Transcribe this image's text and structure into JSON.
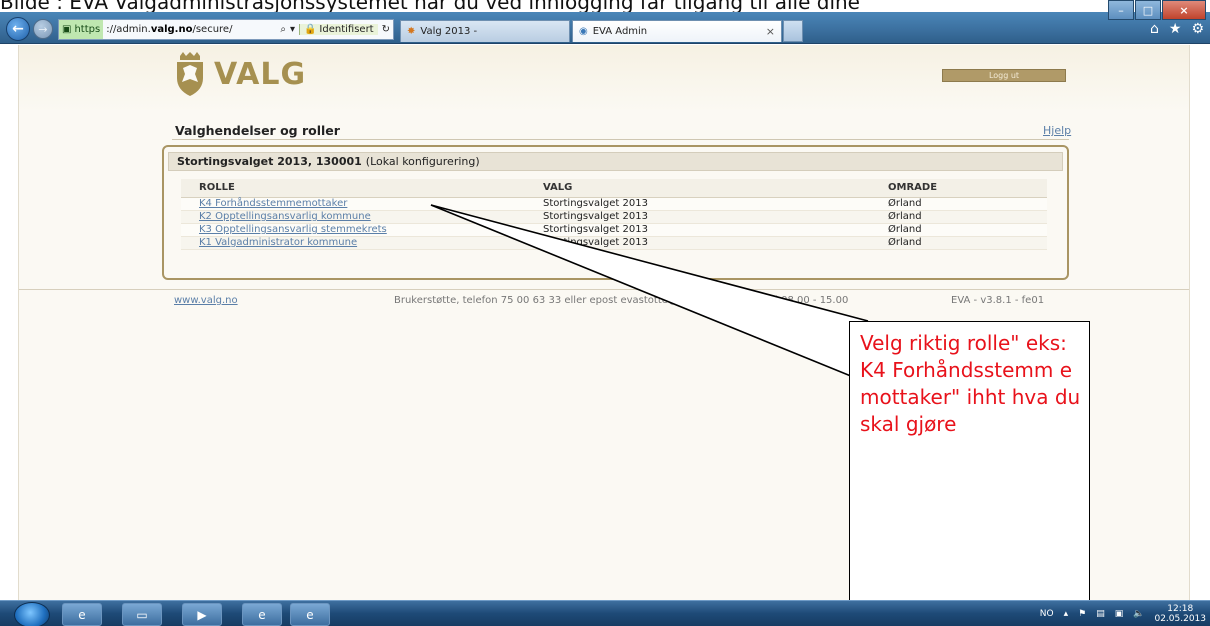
{
  "caption": "Bilde : EVA Valgadministrasjonssystemet når du ved innlogging får tilgang til alle dine",
  "browser": {
    "address": {
      "protocol": "https",
      "prefix": "://admin.",
      "domain": "valg.no",
      "path": "/secure/",
      "search_glyph": "⌕",
      "dropdown_glyph": "▾",
      "identified": "Identifisert",
      "refresh_glyph": "↻"
    },
    "tabs": [
      {
        "label": "Valg 2013 -",
        "close": ""
      },
      {
        "label": "EVA Admin",
        "close": "×"
      }
    ],
    "toolbar": {
      "home": "⌂",
      "favorites": "★",
      "settings": "⚙"
    },
    "controls": {
      "minimize": "–",
      "maximize": "□",
      "close": "×"
    }
  },
  "site": {
    "logo_text": "VALG",
    "logout": "Logg ut"
  },
  "section": {
    "title": "Valghendelser og roller",
    "help": "Hjelp"
  },
  "event": {
    "name": "Stortingsvalget 2013, 130001",
    "mode": "(Lokal konfigurering)"
  },
  "table": {
    "headers": [
      "ROLLE",
      "VALG",
      "OMRADE"
    ],
    "rows": [
      {
        "role": "K4 Forhåndsstemmemottaker",
        "election": "Stortingsvalget 2013",
        "area": "Ørland"
      },
      {
        "role": "K2 Opptellingsansvarlig kommune",
        "election": "Stortingsvalget 2013",
        "area": "Ørland"
      },
      {
        "role": "K3 Opptellingsansvarlig stemmekrets",
        "election": "Stortingsvalget 2013",
        "area": "Ørland"
      },
      {
        "role": "K1 Valgadministrator kommune",
        "election": "Stortingsvalget 2013",
        "area": "Ørland"
      }
    ]
  },
  "footer": {
    "link": "www.valg.no",
    "support": "Brukerstøtte, telefon 75 00 63 33 eller epost evastotte@valg.no - Åpningstid 08.00 - 15.00",
    "version": "EVA - v3.8.1 - fe01"
  },
  "callout": {
    "text": "Velg riktig rolle\" eks: K4 Forhåndsstemm emottaker\" ihht hva du skal gjøre",
    "color": "#e8121b"
  },
  "taskbar": {
    "lang": "NO",
    "time": "12:18",
    "date": "02.05.2013"
  }
}
